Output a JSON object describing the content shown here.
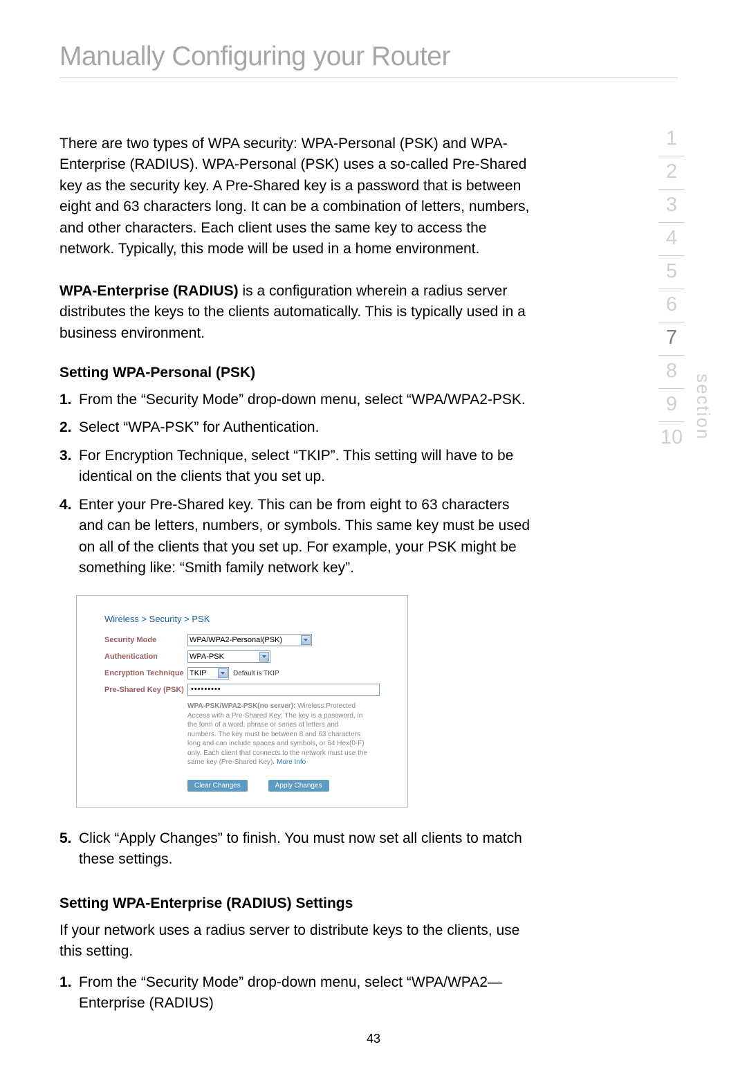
{
  "title": "Manually Configuring your Router",
  "intro": "There are two types of WPA security: WPA-Personal (PSK) and WPA-Enterprise (RADIUS). WPA-Personal (PSK) uses a so-called Pre-Shared key as the security key. A Pre-Shared key is a password that is between eight and 63 characters long. It can be a combination of letters, numbers, and other characters. Each client uses the same key to access the network. Typically, this mode will be used in a home environment.",
  "wpa_ent_label": "WPA-Enterprise (RADIUS)",
  "wpa_ent_rest": " is a configuration wherein a radius server distributes the keys to the clients automatically. This is typically used in a business environment.",
  "heading_psk": "Setting WPA-Personal (PSK)",
  "steps_psk": {
    "s1": "From the “Security Mode” drop-down menu, select “WPA/WPA2-PSK.",
    "s2": "Select “WPA-PSK” for Authentication.",
    "s3": "For Encryption Technique, select “TKIP”. This setting will have to be identical on the clients that you set up.",
    "s4": "Enter your Pre-Shared key. This can be from eight to 63 characters and can be letters, numbers, or symbols. This same key must be used on all of the clients that you set up. For example, your PSK might be something like: “Smith family network key”.",
    "s5": "Click “Apply Changes” to finish. You must now set all clients to match these settings."
  },
  "ui": {
    "breadcrumb": "Wireless > Security > PSK",
    "labels": {
      "security_mode": "Security Mode",
      "authentication": "Authentication",
      "encryption": "Encryption Technique",
      "psk": "Pre-Shared Key (PSK)"
    },
    "values": {
      "security_mode": "WPA/WPA2-Personal(PSK)",
      "authentication": "WPA-PSK",
      "encryption": "TKIP",
      "default_note": "Default is TKIP",
      "psk_masked": "•••••••••"
    },
    "help_bold": "WPA-PSK/WPA2-PSK(no server):",
    "help_rest": " Wireless Protected Access with a Pre-Shared Key: The key is a password, in the form of a word, phrase or series of letters and numbers. The key must be between 8 and 63 characters long and can include spaces and symbols, or 64 Hex(0-F) only. Each client that connects to the network must use the same key (Pre-Shared Key). ",
    "more_info": "More Info",
    "btn_clear": "Clear Changes",
    "btn_apply": "Apply Changes"
  },
  "heading_radius": "Setting WPA-Enterprise (RADIUS) Settings",
  "radius_intro": "If your network uses a radius server to distribute keys to the clients, use this setting.",
  "steps_radius": {
    "s1": "From the “Security Mode” drop-down menu, select “WPA/WPA2—Enterprise (RADIUS)"
  },
  "nav": {
    "n1": "1",
    "n2": "2",
    "n3": "3",
    "n4": "4",
    "n5": "5",
    "n6": "6",
    "n7": "7",
    "n8": "8",
    "n9": "9",
    "n10": "10",
    "section": "section"
  },
  "page_number": "43"
}
